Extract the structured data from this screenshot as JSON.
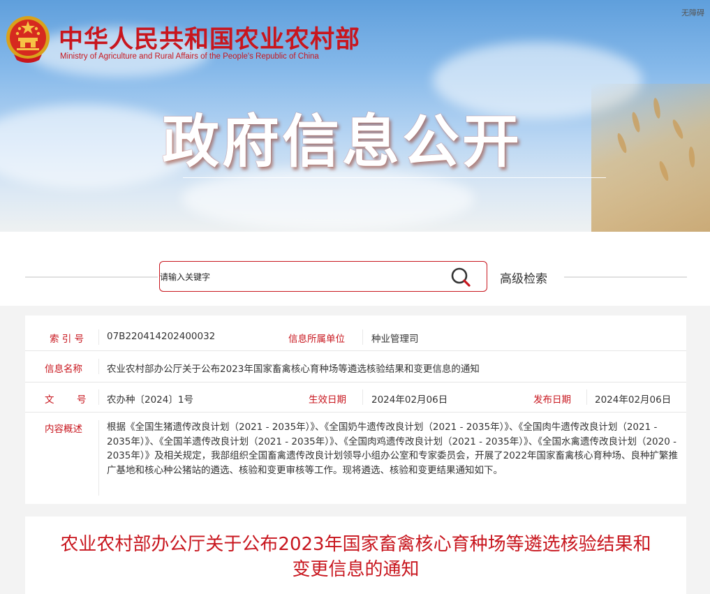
{
  "header": {
    "ministry_cn": "中华人民共和国农业农村部",
    "ministry_en": "Ministry of Agriculture and Rural Affairs of the People's Republic of China",
    "accessibility": "无障碍",
    "banner_title": "政府信息公开",
    "emblem_icon": "national-emblem-icon"
  },
  "search": {
    "placeholder": "请输入关键字",
    "advanced_label": "高级检索",
    "icon": "search-icon"
  },
  "info": {
    "index_label": "索 引 号",
    "index_value": "07B220414202400032",
    "unit_label": "信息所属单位",
    "unit_value": "种业管理司",
    "name_label": "信息名称",
    "name_value": "农业农村部办公厅关于公布2023年国家畜禽核心育种场等遴选核验结果和变更信息的通知",
    "doc_label_a": "文",
    "doc_label_b": "号",
    "doc_value": "农办种〔2024〕1号",
    "effective_label": "生效日期",
    "effective_value": "2024年02月06日",
    "publish_label": "发布日期",
    "publish_value": "2024年02月06日",
    "summary_label": "内容概述",
    "summary_value": "根据《全国生猪遗传改良计划（2021 - 2035年）》、《全国奶牛遗传改良计划（2021 - 2035年）》、《全国肉牛遗传改良计划（2021 - 2035年）》、《全国羊遗传改良计划（2021 - 2035年）》、《全国肉鸡遗传改良计划（2021 - 2035年）》、《全国水禽遗传改良计划（2020 - 2035年）》及相关规定，我部组织全国畜禽遗传改良计划领导小组办公室和专家委员会，开展了2022年国家畜禽核心育种场、良种扩繁推广基地和核心种公猪站的遴选、核验和变更审核等工作。现将遴选、核验和变更结果通知如下。"
  },
  "article": {
    "title": "农业农村部办公厅关于公布2023年国家畜禽核心育种场等遴选核验结果和变更信息的通知"
  },
  "colors": {
    "accent": "#c8161e",
    "text": "#333333",
    "page_bg": "#f3f3f3"
  }
}
